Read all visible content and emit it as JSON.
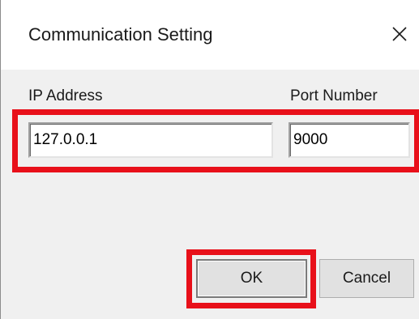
{
  "window": {
    "title": "Communication Setting",
    "close_icon": "close-icon"
  },
  "form": {
    "ip_label": "IP Address",
    "ip_value": "127.0.0.1",
    "port_label": "Port Number",
    "port_value": "9000"
  },
  "buttons": {
    "ok_label": "OK",
    "cancel_label": "Cancel"
  },
  "colors": {
    "highlight": "#e8101a",
    "dialog_bg": "#f0f0f0",
    "titlebar_bg": "#ffffff"
  }
}
